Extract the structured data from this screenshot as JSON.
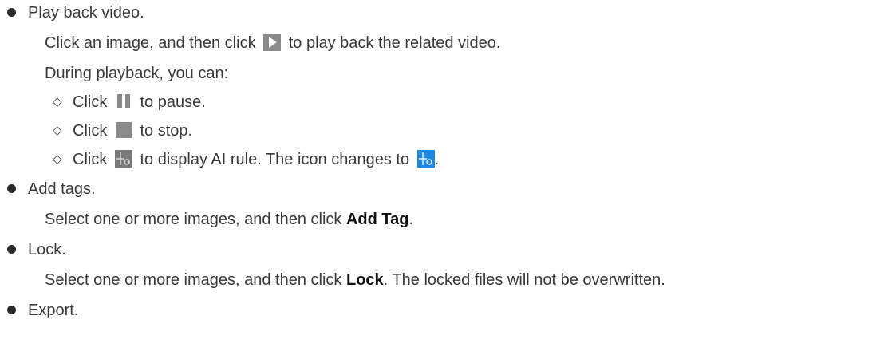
{
  "items": [
    {
      "title": "Play back video.",
      "line1_pre": "Click an image, and then click",
      "line1_post": "to play back the related video.",
      "line2": "During playback, you can:",
      "subitems": [
        {
          "pre": "Click",
          "icon": "pause-icon",
          "post": "to pause."
        },
        {
          "pre": "Click",
          "icon": "stop-icon",
          "post": "to stop."
        },
        {
          "pre": "Click",
          "icon": "ai-rule-icon",
          "mid": "to display AI rule. The icon changes to",
          "icon2": "ai-rule-active-icon",
          "post": "."
        }
      ]
    },
    {
      "title": "Add tags.",
      "line_pre": "Select one or more images, and then click",
      "bold": "Add Tag",
      "line_post": "."
    },
    {
      "title": "Lock.",
      "line_pre": "Select one or more images, and then click",
      "bold": "Lock",
      "line_post": ". The locked files will not be overwritten."
    },
    {
      "title": "Export."
    }
  ],
  "colors": {
    "text": "#3a3a3a",
    "icon_gray": "#8a8a8a",
    "icon_blue": "#1e88e5"
  }
}
